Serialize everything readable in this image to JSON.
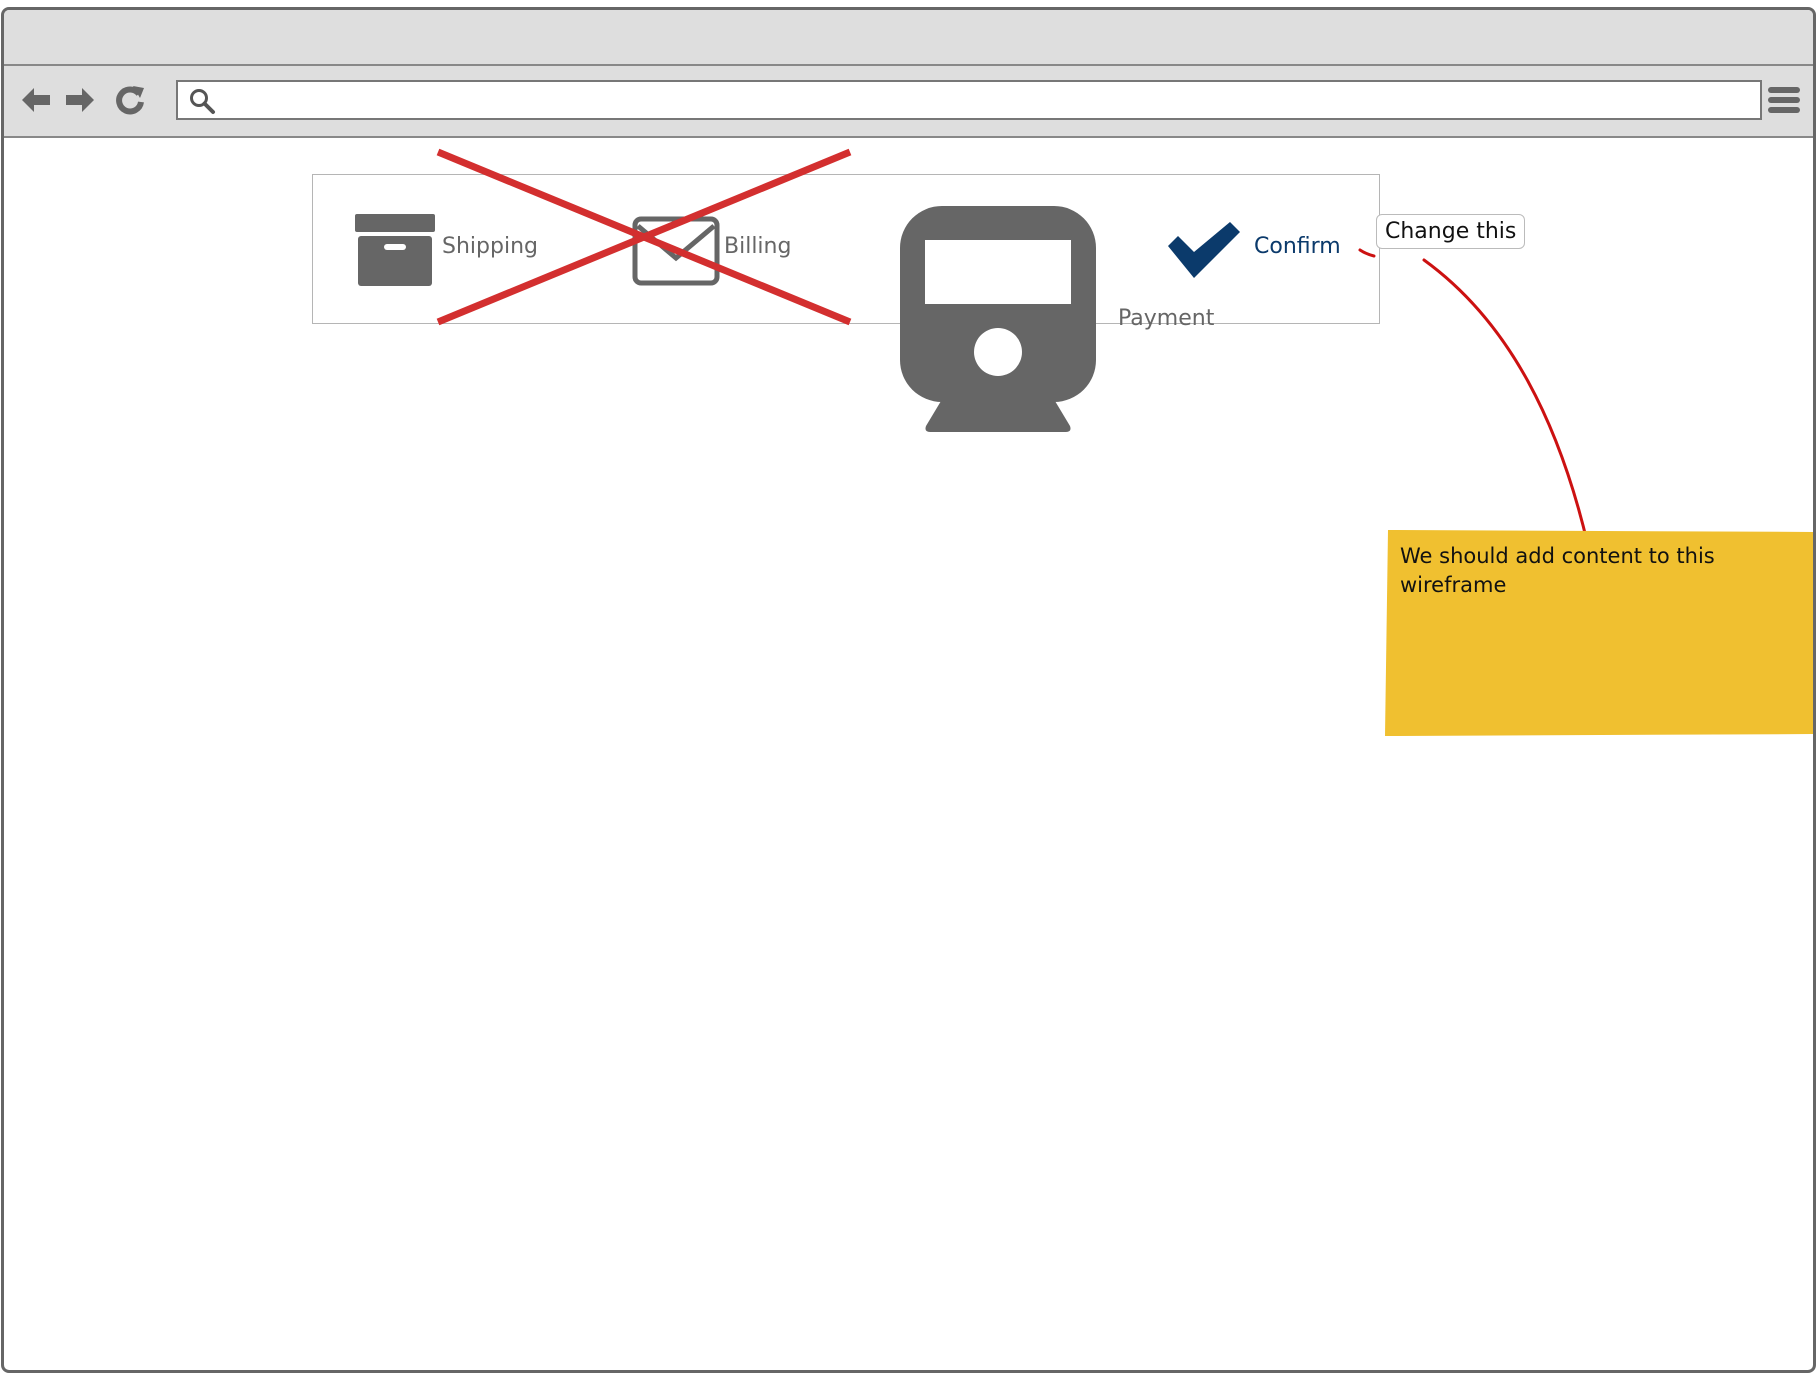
{
  "browser": {
    "address": {
      "value": "",
      "placeholder": ""
    },
    "nav": {
      "back_icon": "arrow-left-icon",
      "forward_icon": "arrow-right-icon",
      "reload_icon": "reload-icon",
      "search_icon": "search-icon",
      "menu_icon": "hamburger-menu-icon"
    }
  },
  "stepper": {
    "steps": [
      {
        "label": "Shipping",
        "icon": "archive-box-icon",
        "color": "#666666"
      },
      {
        "label": "Billing",
        "icon": "envelope-icon",
        "color": "#666666"
      },
      {
        "label": "Payment",
        "icon": "train-icon",
        "color": "#666666"
      },
      {
        "label": "Confirm",
        "icon": "checkmark-icon",
        "color": "#0b3a6b"
      }
    ],
    "strike_color": "#d32f2f"
  },
  "annotations": {
    "callout": "Change this",
    "arrow_color": "#cc1111",
    "sticky_note": "We should add content to this wireframe",
    "sticky_color": "#f0c030"
  }
}
